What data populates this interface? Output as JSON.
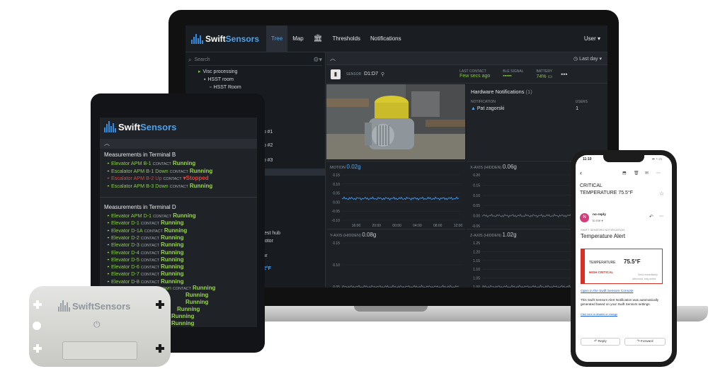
{
  "brand": {
    "part1": "Swift",
    "part2": "Sensors"
  },
  "laptop": {
    "nav": {
      "tree": "Tree",
      "map": "Map",
      "thresholds": "Thresholds",
      "notifications": "Notifications",
      "user": "User ▾"
    },
    "search_placeholder": "Search",
    "tree": [
      "Visc processing",
      "HSST room",
      "HSST Room"
    ],
    "tree_fragments": [
      "mp #1",
      "mp #2",
      "mp #3",
      "west hub",
      "motor",
      "sor",
      "82°F"
    ],
    "toolbar": {
      "range": "Last day ▾"
    },
    "sensor": {
      "label": "SENSOR",
      "id": "D1:D7",
      "last_contact_label": "LAST CONTACT",
      "last_contact": "Few secs ago",
      "ble_label": "BLE SIGNAL",
      "battery_label": "BATTERY",
      "battery": "74%"
    },
    "hardware": {
      "title": "Hardware Notifications",
      "count": "(1)",
      "col1": "NOTIFICATION",
      "col2": "USERS",
      "name": "Pat zagorski",
      "users": "1"
    },
    "charts": [
      {
        "label": "MOTION",
        "value": "0.02g",
        "yticks": [
          "0.15",
          "0.10",
          "0.05",
          "0.00",
          "-0.05",
          "-0.10"
        ],
        "xticks": [
          "16:00",
          "20:00",
          "00:00",
          "04:00",
          "08:00",
          "12:00"
        ]
      },
      {
        "label": "X-AXIS (HIDDEN)",
        "value": "0.06g",
        "yticks": [
          "0.20",
          "0.15",
          "0.10",
          "0.05",
          "0.00",
          "-0.05"
        ],
        "xticks": []
      },
      {
        "label": "Y-AXIS (HIDDEN)",
        "value": "0.08g",
        "yticks": [
          "0.15",
          "0.10",
          "0.05"
        ],
        "xticks": []
      },
      {
        "label": "Z-AXIS (HIDDEN)",
        "value": "1.02g",
        "yticks": [
          "1.25",
          "1.20",
          "1.15",
          "1.10",
          "1.05",
          "1.00"
        ],
        "xticks": []
      }
    ]
  },
  "tablet": {
    "section1": "Measurements in Terminal B",
    "terminal_b": [
      {
        "name": "Elevator APM B-1",
        "contact": "CONTACT",
        "status": "Running",
        "alert": false
      },
      {
        "name": "Escalator APM B-1 Down",
        "contact": "CONTACT",
        "status": "Running",
        "alert": false
      },
      {
        "name": "Escalator APM B-2 Up",
        "contact": "CONTACT",
        "status": "Stopped",
        "alert": true
      },
      {
        "name": "Escalator APM B-3 Down",
        "contact": "CONTACT",
        "status": "Running",
        "alert": false
      }
    ],
    "section2": "Measurements in Terminal D",
    "terminal_d": [
      {
        "name": "Elevator APM D-1",
        "contact": "CONTACT",
        "status": "Running"
      },
      {
        "name": "Elevator D-1",
        "contact": "CONTACT",
        "status": "Running"
      },
      {
        "name": "Elevator D-1A",
        "contact": "CONTACT",
        "status": "Running"
      },
      {
        "name": "Elevator D-2",
        "contact": "CONTACT",
        "status": "Running"
      },
      {
        "name": "Elevator D-3",
        "contact": "CONTACT",
        "status": "Running"
      },
      {
        "name": "Elevator D-4",
        "contact": "CONTACT",
        "status": "Running"
      },
      {
        "name": "Elevator D-5",
        "contact": "CONTACT",
        "status": "Running"
      },
      {
        "name": "Elevator D-6",
        "contact": "CONTACT",
        "status": "Running"
      },
      {
        "name": "Elevator D-7",
        "contact": "CONTACT",
        "status": "Running"
      },
      {
        "name": "Elevator D-8",
        "contact": "CONTACT",
        "status": "Running"
      }
    ],
    "partial": [
      "own",
      "CONTACT",
      "Running",
      "Running",
      "Running",
      "Running",
      "Running",
      "Running"
    ]
  },
  "phone": {
    "time": "11:10",
    "subject1": "CRITICAL",
    "subject2": "TEMPERATURE 75.5°F",
    "sender": "no-reply",
    "to": "to me ▾",
    "notif_label": "SWIFT SENSORS NOTIFICATION",
    "notif_title": "Temperature Alert",
    "temp_label": "TEMPERATURE",
    "temp_value": "75.5°F",
    "severity": "HIGH CRITICAL",
    "send_note1": "Send immediately",
    "send_note2": "Afterward, stay active",
    "console_link": "Open in the Swift Sensors Console",
    "body": "This Swift Sensors Alert Notification was automatically generated based on your Swift Sensors settings.",
    "unsub": "Click here to disable or change",
    "reply": "Reply",
    "forward": "Forward"
  },
  "colors": {
    "accent_blue": "#4ea8f0",
    "running_green": "#98d64c",
    "alert_red": "#e0453e"
  }
}
